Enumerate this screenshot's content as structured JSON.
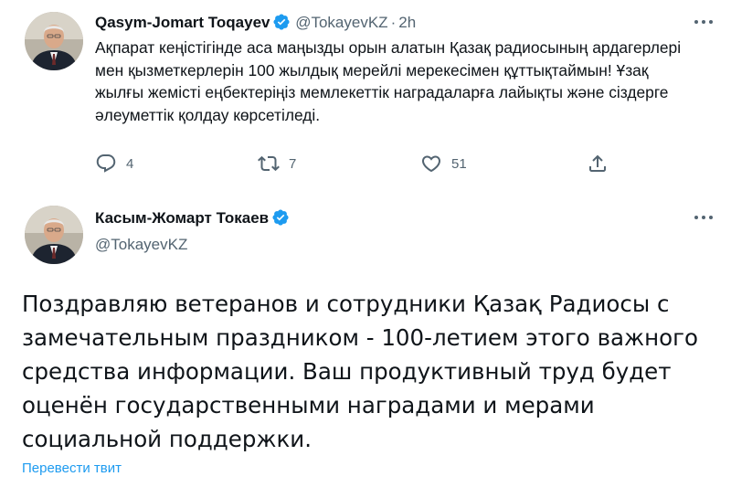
{
  "tweet1": {
    "author_name": "Qasym-Jomart Toqayev",
    "handle": "@TokayevKZ",
    "separator": "·",
    "time": "2h",
    "text": "Ақпарат кеңістігінде аса маңызды орын алатын Қазақ радиосының ардагерлері мен қызметкерлерін 100 жылдық мерейлі мерекесімен құттықтаймын! Ұзақ жылғы жемісті еңбектеріңіз мемлекеттік наградаларға лайықты және сіздерге әлеуметтік қолдау көрсетіледі.",
    "actions": {
      "reply_count": "4",
      "retweet_count": "7",
      "like_count": "51"
    }
  },
  "tweet2": {
    "author_name": "Касым-Жомарт Токаев",
    "handle": "@TokayevKZ",
    "text": "Поздравляю ветеранов и сотрудники Қазақ Радиосы с замечательным праздником - 100-летием этого важного средства информации. Ваш продуктивный труд будет оценён государственными наградами и мерами социальной поддержки.",
    "translate_link": "Перевести твит"
  },
  "icons": {
    "verified": "verified-badge-icon",
    "more": "more-options-icon",
    "reply": "reply-icon",
    "retweet": "retweet-icon",
    "like": "heart-icon",
    "share": "share-icon"
  },
  "colors": {
    "accent": "#1d9bf0",
    "secondary_text": "#536471",
    "primary_text": "#0f1419"
  }
}
